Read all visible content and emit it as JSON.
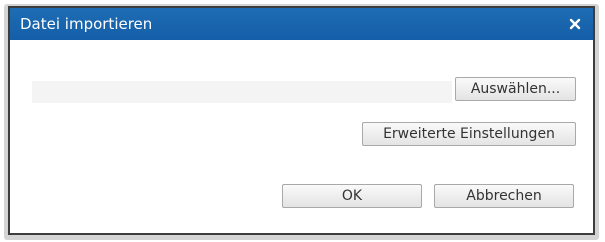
{
  "dialog": {
    "title": "Datei importieren",
    "close_icon": "close-icon",
    "select_label": "Auswählen...",
    "advanced_label": "Erweiterte Einstellungen",
    "ok_label": "OK",
    "cancel_label": "Abbrechen"
  },
  "colors": {
    "titlebar": "#1565ad",
    "title_text": "#ffffff",
    "button_border": "#a9a9a9",
    "dialog_border": "#3d3d3d"
  }
}
